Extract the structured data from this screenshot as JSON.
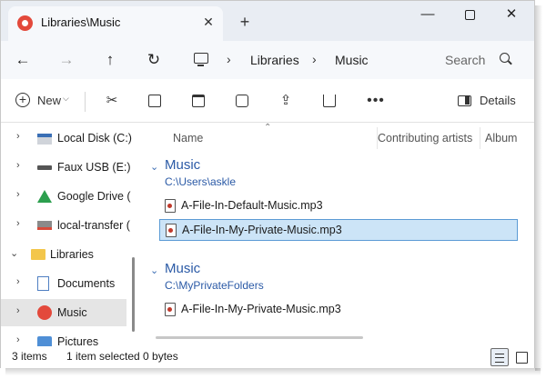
{
  "window": {
    "tab_title": "Libraries\\Music",
    "tab_close": "✕",
    "new_tab": "+",
    "minimize": "—",
    "close": "✕"
  },
  "navbar": {
    "back": "←",
    "forward": "→",
    "up": "↑",
    "refresh": "↻",
    "breadcrumb": [
      "Libraries",
      "Music"
    ],
    "separator": "›",
    "search_placeholder": "Search"
  },
  "commandbar": {
    "new_label": "New",
    "new_caret": "⌵",
    "more": "•••",
    "details_label": "Details"
  },
  "sidebar": {
    "items": [
      {
        "label": "Local Disk (C:)",
        "icon": "disk-icon",
        "chevron": "›"
      },
      {
        "label": "Faux USB (E:)",
        "icon": "usb-drive-icon",
        "chevron": "›"
      },
      {
        "label": "Google Drive (",
        "icon": "google-drive-icon",
        "chevron": "›"
      },
      {
        "label": "local-transfer (",
        "icon": "network-drive-icon",
        "chevron": "›"
      },
      {
        "label": "Libraries",
        "icon": "folder-icon",
        "chevron": "⌄"
      },
      {
        "label": "Documents",
        "icon": "documents-icon",
        "chevron": "›"
      },
      {
        "label": "Music",
        "icon": "music-icon",
        "chevron": "›",
        "selected": true
      },
      {
        "label": "Pictures",
        "icon": "pictures-icon",
        "chevron": "›"
      }
    ]
  },
  "main": {
    "columns": [
      "Name",
      "Contributing artists",
      "Album"
    ],
    "sort_indicator": "⌃",
    "groups": [
      {
        "title": "Music",
        "path": "C:\\Users\\askle",
        "chevron": "⌄",
        "files": [
          {
            "name": "A-File-In-Default-Music.mp3",
            "selected": false
          },
          {
            "name": "A-File-In-My-Private-Music.mp3",
            "selected": true
          }
        ]
      },
      {
        "title": "Music",
        "path": "C:\\MyPrivateFolders",
        "chevron": "⌄",
        "files": [
          {
            "name": "A-File-In-My-Private-Music.mp3",
            "selected": false
          }
        ]
      }
    ]
  },
  "status": {
    "item_count": "3 items",
    "selection": "1 item selected  0 bytes"
  },
  "colors": {
    "accent": "#2b5aa6",
    "selection_bg": "#cce4f7",
    "selection_border": "#5b9bd5",
    "music_icon": "#e3493b"
  }
}
